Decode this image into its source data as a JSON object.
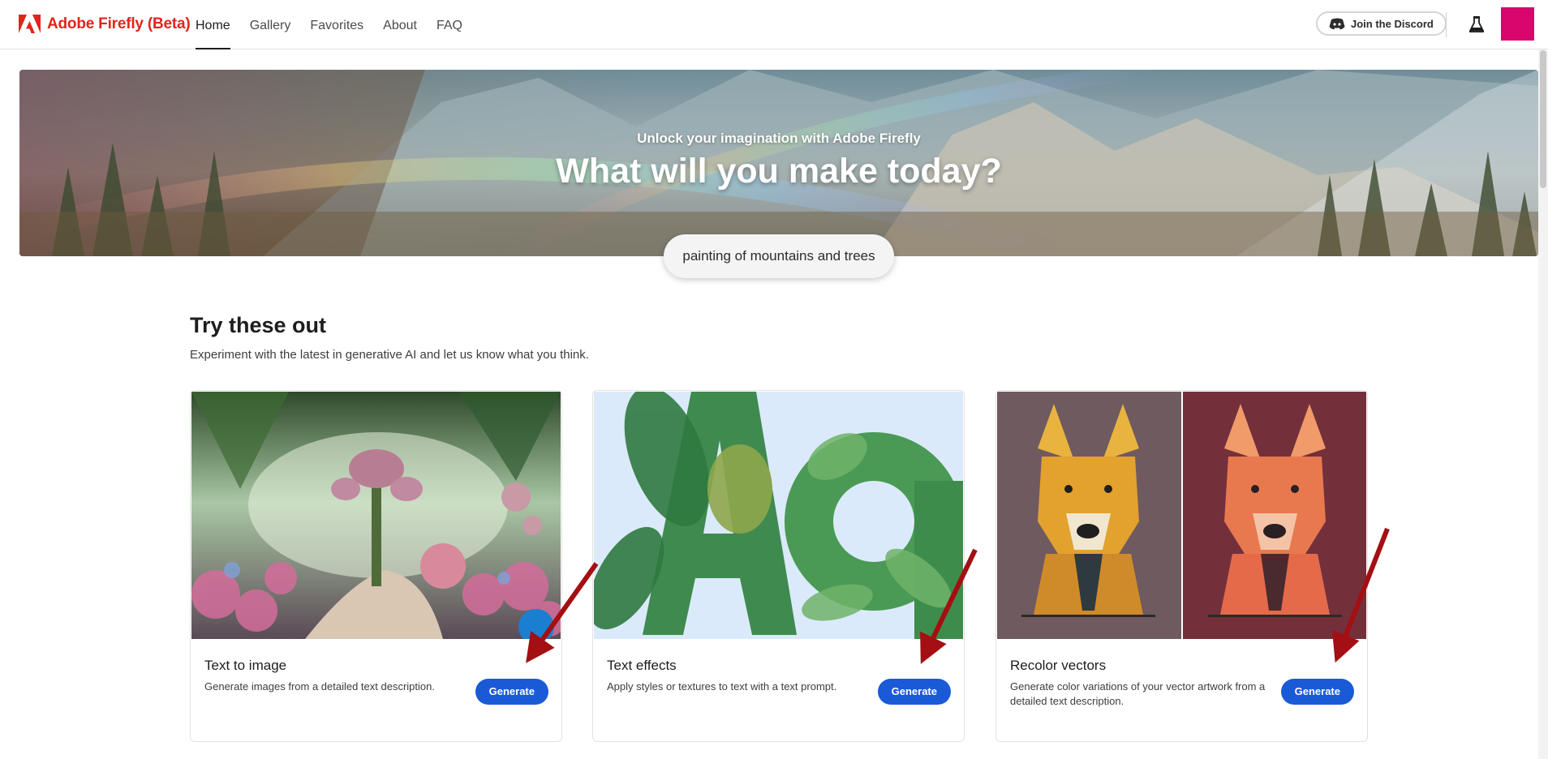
{
  "brand": {
    "name": "Adobe Firefly (Beta)",
    "logo_icon": "adobe-logo-icon",
    "color": "#e1251b"
  },
  "nav": {
    "items": [
      {
        "label": "Home",
        "active": true
      },
      {
        "label": "Gallery",
        "active": false
      },
      {
        "label": "Favorites",
        "active": false
      },
      {
        "label": "About",
        "active": false
      },
      {
        "label": "FAQ",
        "active": false
      }
    ]
  },
  "header": {
    "discord_label": "Join the Discord",
    "discord_icon": "discord-icon",
    "labs_icon": "flask-icon",
    "avatar_color": "#d8066d"
  },
  "hero": {
    "subtitle": "Unlock your imagination with Adobe Firefly",
    "title": "What will you make today?",
    "prompt": "painting of mountains and trees"
  },
  "section": {
    "title": "Try these out",
    "description": "Experiment with the latest in generative AI and let us know what you think."
  },
  "cards": [
    {
      "title": "Text to image",
      "description": "Generate images from a detailed text description.",
      "button": "Generate"
    },
    {
      "title": "Text effects",
      "description": "Apply styles or textures to text with a text prompt.",
      "button": "Generate"
    },
    {
      "title": "Recolor vectors",
      "description": "Generate color variations of your vector artwork from a detailed text description.",
      "button": "Generate"
    }
  ],
  "colors": {
    "accent_button": "#1a5ad7",
    "annotation_arrow": "#a30f12"
  }
}
